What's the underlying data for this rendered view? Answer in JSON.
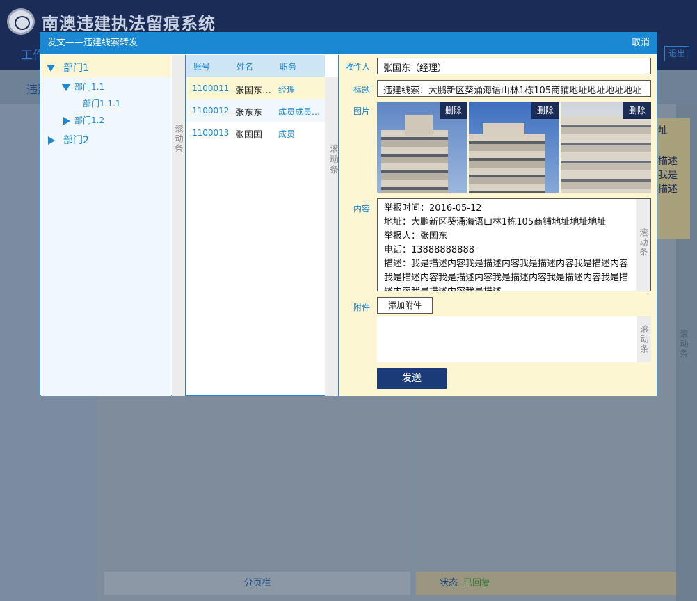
{
  "app": {
    "title": "南澳违建执法留痕系统",
    "bg_tab": "工作",
    "bg_subtab": "违建",
    "exit_label": "退出"
  },
  "background": {
    "doc_lines": [
      "址",
      "描述",
      "我是",
      "描述"
    ],
    "footer_pager": "分页栏",
    "status_label": "状态",
    "status_value": "已回复",
    "far_scroll": "滚动条"
  },
  "dialog": {
    "title": "发文——违建线索转发",
    "cancel_label": "取消",
    "tree": [
      {
        "label": "部门1",
        "level": 0,
        "expanded": true,
        "selected": true
      },
      {
        "label": "部门1.1",
        "level": 1,
        "expanded": true
      },
      {
        "label": "部门1.1.1",
        "level": 2
      },
      {
        "label": "部门1.2",
        "level": 1,
        "expanded": false
      },
      {
        "label": "部门2",
        "level": 0,
        "expanded": false
      }
    ],
    "tree_scroll": "滚动条",
    "table": {
      "headers": [
        "账号",
        "姓名",
        "职务"
      ],
      "rows": [
        {
          "account": "1100011",
          "name": "张国东（经理）",
          "role": "经理",
          "selected": true
        },
        {
          "account": "1100012",
          "name": "张东东",
          "role": "成员成员成员"
        },
        {
          "account": "1100013",
          "name": "张国国",
          "role": "成员"
        }
      ],
      "scroll": "滚动条"
    },
    "form": {
      "recipient_label": "收件人",
      "recipient_value": "张国东（经理）",
      "title_label": "标题",
      "title_value": "违建线索：大鹏新区葵涌海语山林1栋105商铺地址地址地址地址",
      "images_label": "图片",
      "delete_label": "删除",
      "content_label": "内容",
      "content_lines": [
        "举报时间：2016-05-12",
        "地址：大鹏新区葵涌海语山林1栋105商铺地址地址地址",
        "举报人：张国东",
        "电话：13888888888",
        "描述：我是描述内容我是描述内容我是描述内容我是描述内容我是描述内容我是描述内容我是描述内容我是描述内容我是描述内容我是描述内容我是描述"
      ],
      "content_scroll": "滚动条",
      "attachment_label": "附件",
      "add_attachment_label": "添加附件",
      "attachment_scroll": "滚动条",
      "send_label": "发送"
    }
  }
}
